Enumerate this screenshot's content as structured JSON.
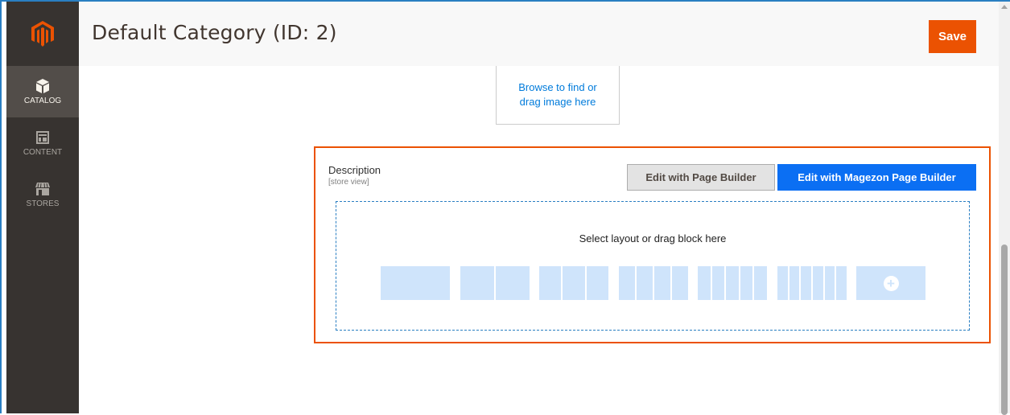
{
  "header": {
    "title": "Default Category (ID: 2)",
    "save_label": "Save"
  },
  "sidebar": {
    "items": [
      {
        "label": "CATALOG",
        "icon": "catalog-cube-icon",
        "active": true
      },
      {
        "label": "CONTENT",
        "icon": "content-layout-icon",
        "active": false
      },
      {
        "label": "STORES",
        "icon": "stores-storefront-icon",
        "active": false
      }
    ]
  },
  "upload": {
    "text": "Browse to find or drag image here"
  },
  "description": {
    "label": "Description",
    "scope": "[store view]",
    "page_builder_button": "Edit with Page Builder",
    "magezon_button": "Edit with Magezon Page Builder",
    "drop_text": "Select layout or drag block here",
    "layouts": [
      1,
      2,
      3,
      4,
      5,
      6
    ]
  },
  "colors": {
    "accent": "#eb5202",
    "sidebar_bg": "#373330",
    "primary_button": "#0b6ff3",
    "layout_block": "#cfe4fb"
  }
}
